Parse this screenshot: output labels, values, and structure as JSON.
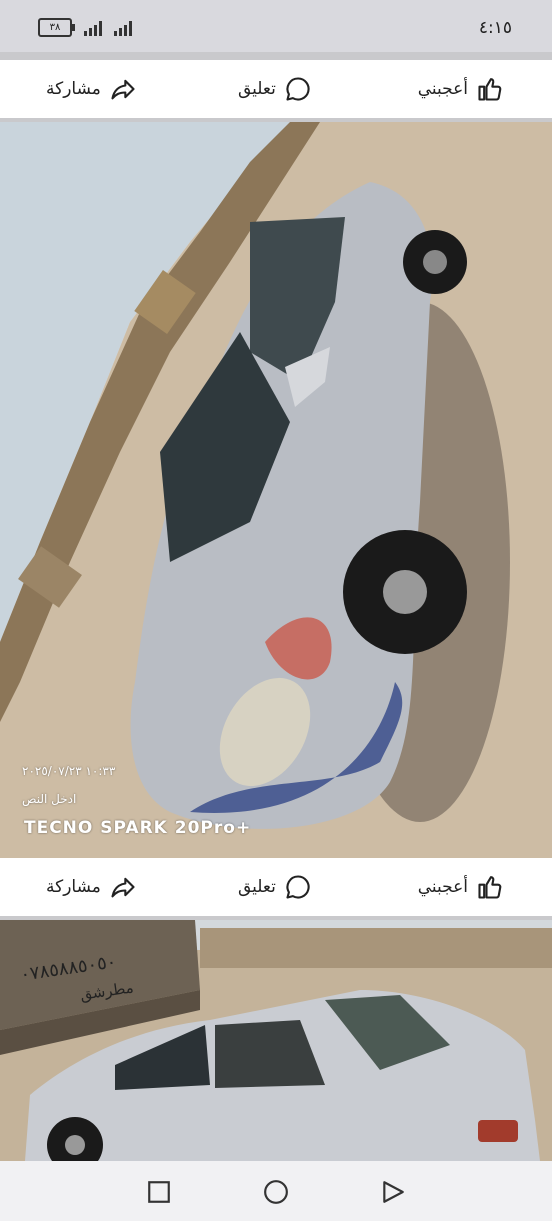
{
  "status": {
    "time": "٤:١٥",
    "battery": "٣٨"
  },
  "posts": [
    {
      "like_label": "أعجبني",
      "comment_label": "تعليق",
      "share_label": "مشاركة"
    },
    {
      "like_label": "أعجبني",
      "comment_label": "تعليق",
      "share_label": "مشاركة"
    }
  ],
  "photo1": {
    "timestamp": "١٠:٣٣ ٢٠٢٥/٠٧/٢٣",
    "caption": "ادخل النص",
    "camera_brand": "TECNO SPARK 20Pro+"
  },
  "photo2": {
    "wall_text": "٠٧٨٥٨٨٥٠٥٠",
    "wall_text2": "مطرشق"
  },
  "colors": {
    "accent": "#222222",
    "bar": "#ffffff"
  },
  "icons": [
    "thumbs-up-icon",
    "comment-bubble-icon",
    "share-arrow-icon",
    "square-icon",
    "circle-icon",
    "triangle-icon"
  ]
}
